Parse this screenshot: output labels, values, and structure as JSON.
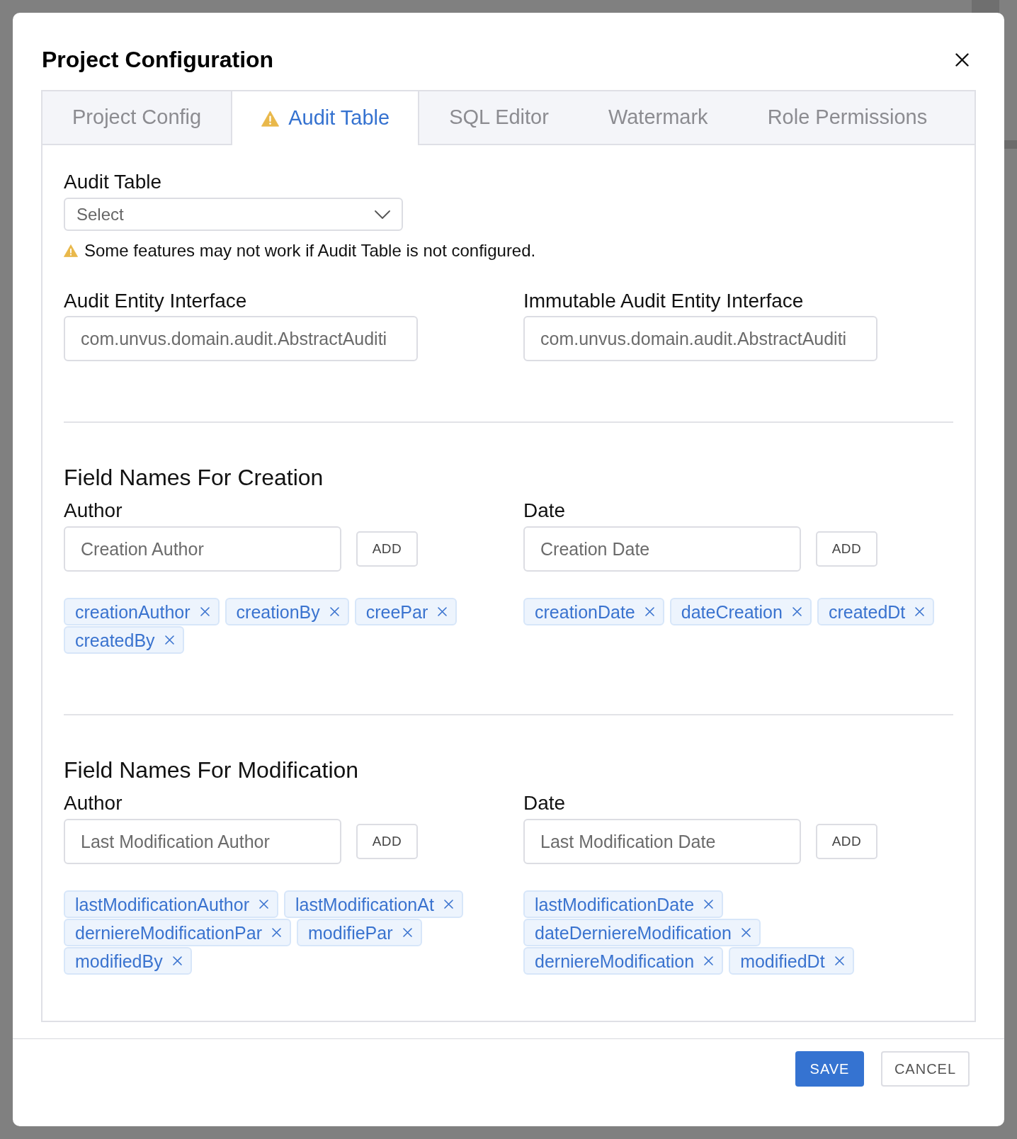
{
  "dialog": {
    "title": "Project Configuration"
  },
  "tabs": [
    {
      "label": "Project Config",
      "selected": false,
      "warning": false
    },
    {
      "label": "Audit Table",
      "selected": true,
      "warning": true
    },
    {
      "label": "SQL Editor",
      "selected": false,
      "warning": false
    },
    {
      "label": "Watermark",
      "selected": false,
      "warning": false
    },
    {
      "label": "Role Permissions",
      "selected": false,
      "warning": false
    }
  ],
  "audit_table": {
    "label": "Audit Table",
    "select": {
      "placeholder": "Select"
    },
    "warning": "Some features may not work if Audit Table is not configured."
  },
  "interfaces": [
    {
      "label": "Audit Entity Interface",
      "placeholder": "com.unvus.domain.audit.AbstractAuditi"
    },
    {
      "label": "Immutable Audit Entity Interface",
      "placeholder": "com.unvus.domain.audit.AbstractAuditi"
    }
  ],
  "sections": [
    {
      "title": "Field Names For Creation",
      "groups": [
        {
          "label": "Author",
          "placeholder": "Creation Author",
          "button": "ADD",
          "tags": [
            "creationAuthor",
            "creationBy",
            "creePar",
            "createdBy"
          ]
        },
        {
          "label": "Date",
          "placeholder": "Creation Date",
          "button": "ADD",
          "tags": [
            "creationDate",
            "dateCreation",
            "createdDt"
          ]
        }
      ]
    },
    {
      "title": "Field Names For Modification",
      "groups": [
        {
          "label": "Author",
          "placeholder": "Last Modification Author",
          "button": "ADD",
          "tags": [
            "lastModificationAuthor",
            "lastModificationAt",
            "derniereModificationPar",
            "modifiePar",
            "modifiedBy"
          ]
        },
        {
          "label": "Date",
          "placeholder": "Last Modification Date",
          "button": "ADD",
          "tags": [
            "lastModificationDate",
            "dateDerniereModification",
            "derniereModification",
            "modifiedDt"
          ]
        }
      ]
    }
  ],
  "footer": {
    "buttons": [
      {
        "label": "SAVE",
        "kind": "primary"
      },
      {
        "label": "CANCEL",
        "kind": "secondary"
      }
    ]
  }
}
